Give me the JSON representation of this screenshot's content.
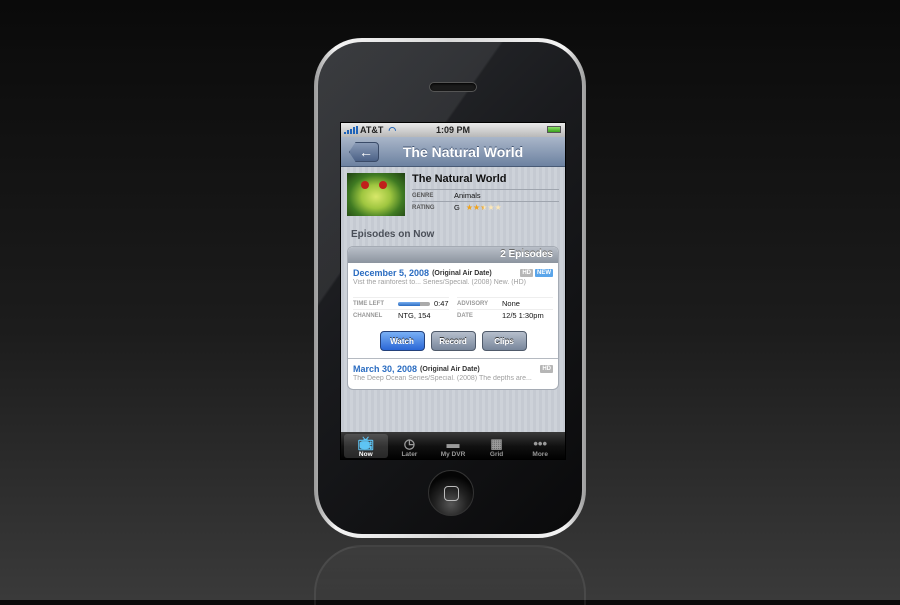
{
  "status_bar": {
    "carrier": "AT&T",
    "time": "1:09 PM"
  },
  "nav": {
    "back_icon": "←",
    "title": "The Natural World"
  },
  "show": {
    "title": "The Natural World",
    "genre_label": "GENRE",
    "genre": "Animals",
    "rating_label": "RATING",
    "rating": "G",
    "stars_filled": 2.5,
    "stars_total": 5
  },
  "episodes_section": {
    "title": "Episodes on Now",
    "count_label": "2 Episodes",
    "episodes": [
      {
        "date": "December 5, 2008",
        "date_note": "(Original Air Date)",
        "badges": [
          "HD",
          "NEW"
        ],
        "description": "Vist the rainforest to... Series/Special. (2008) New. (HD)",
        "time_left_label": "TIME LEFT",
        "time_left_progress": 0.7,
        "time_left": "0:47",
        "advisory_label": "ADVISORY",
        "advisory": "None",
        "channel_label": "CHANNEL",
        "channel": "NTG, 154",
        "date_label": "DATE",
        "date_value": "12/5  1:30pm",
        "actions": {
          "watch": "Watch",
          "record": "Record",
          "clips": "Clips"
        }
      },
      {
        "date": "March 30, 2008",
        "date_note": "(Original Air Date)",
        "badges": [
          "HD"
        ],
        "description": "The Deep Ocean Series/Special. (2008) The depths are..."
      }
    ]
  },
  "tabbar": {
    "tabs": [
      {
        "label": "Now",
        "icon": "tv-icon",
        "active": true
      },
      {
        "label": "Later",
        "icon": "tv-clock-icon",
        "active": false
      },
      {
        "label": "My DVR",
        "icon": "dvr-icon",
        "active": false
      },
      {
        "label": "Grid",
        "icon": "grid-icon",
        "active": false
      },
      {
        "label": "More",
        "icon": "more-icon",
        "active": false
      }
    ]
  },
  "colors": {
    "accent_blue": "#2a6cc1",
    "nav_bar": "#6d82a1",
    "badge_new": "#5aa5ea",
    "star": "#f0a21a"
  }
}
